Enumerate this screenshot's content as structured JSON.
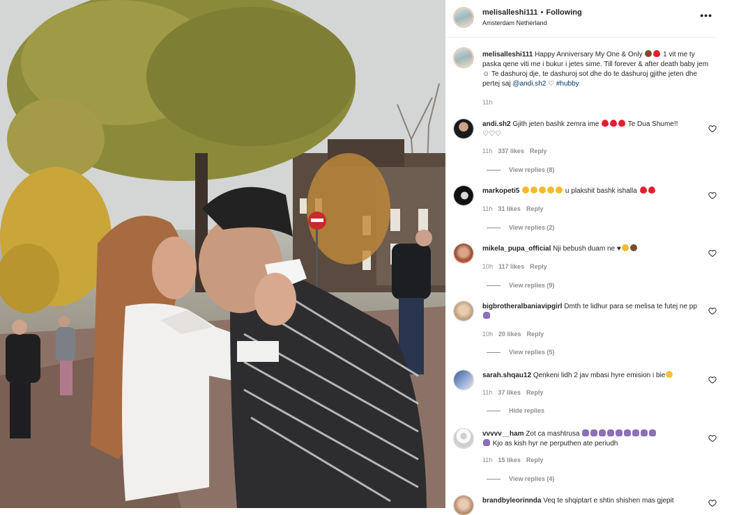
{
  "post": {
    "username": "melisalleshi111",
    "dot": "•",
    "follow_state": "Following",
    "location": "Amsterdam Netherland",
    "more": "•••",
    "caption": {
      "username": "melisalleshi111",
      "text": "Happy Anniversary My One & Only",
      "text2": "1 vit me ty paska qene viti me i bukur i jetes sime. Till forever & after death baby jem",
      "text3": "Te dashuroj dje, te dashuroj sot dhe do te dashuroj gjithe jeten dhe pertej saj",
      "mention": "@andi.sh2",
      "hashtag": "#hubby",
      "time": "11h"
    }
  },
  "comments": [
    {
      "username": "andi.sh2",
      "text_before": "Gjith jeten bashk zemra ime",
      "text_after": "Te Dua Shume!!",
      "time": "11h",
      "likes": "337 likes",
      "reply": "Reply",
      "replies": "View replies (8)"
    },
    {
      "username": "markopeti5",
      "text_before": "",
      "text_after": "u plakshit bashk ishalla",
      "time": "11h",
      "likes": "31 likes",
      "reply": "Reply",
      "replies": "View replies (2)"
    },
    {
      "username": "mikela_pupa_official",
      "text_before": "Nji bebush duam ne",
      "text_after": "",
      "time": "10h",
      "likes": "117 likes",
      "reply": "Reply",
      "replies": "View replies (9)"
    },
    {
      "username": "bigbrotheralbaniavipgirl",
      "text_before": "Dmth te lidhur para se melisa te futej ne pp",
      "text_after": "",
      "time": "10h",
      "likes": "20 likes",
      "reply": "Reply",
      "replies": "View replies (5)"
    },
    {
      "username": "sarah.shqau12",
      "text_before": "Qenkeni lidh 2 jav mbasi hyre emision i bie",
      "text_after": "",
      "time": "11h",
      "likes": "37 likes",
      "reply": "Reply",
      "replies": "Hide replies"
    },
    {
      "username": "vvvvv__ham",
      "text_before": "Zot ca mashtrusa",
      "text_after": "Kjo as kish hyr ne perputhen ate periudh",
      "time": "11h",
      "likes": "15 likes",
      "reply": "Reply",
      "replies": "View replies (4)"
    },
    {
      "username": "brandbyleorinnda",
      "text_before": "Veq te shqiptart e shtin shishen mas gjepit",
      "text_after": "",
      "time": "",
      "likes": "",
      "reply": "",
      "replies": ""
    }
  ],
  "icons": {
    "more": "more-options-icon",
    "heart": "heart-outline-icon"
  },
  "colors": {
    "text": "#262626",
    "secondary": "#8e8e8e",
    "link": "#00376b",
    "divider": "#efefef"
  }
}
